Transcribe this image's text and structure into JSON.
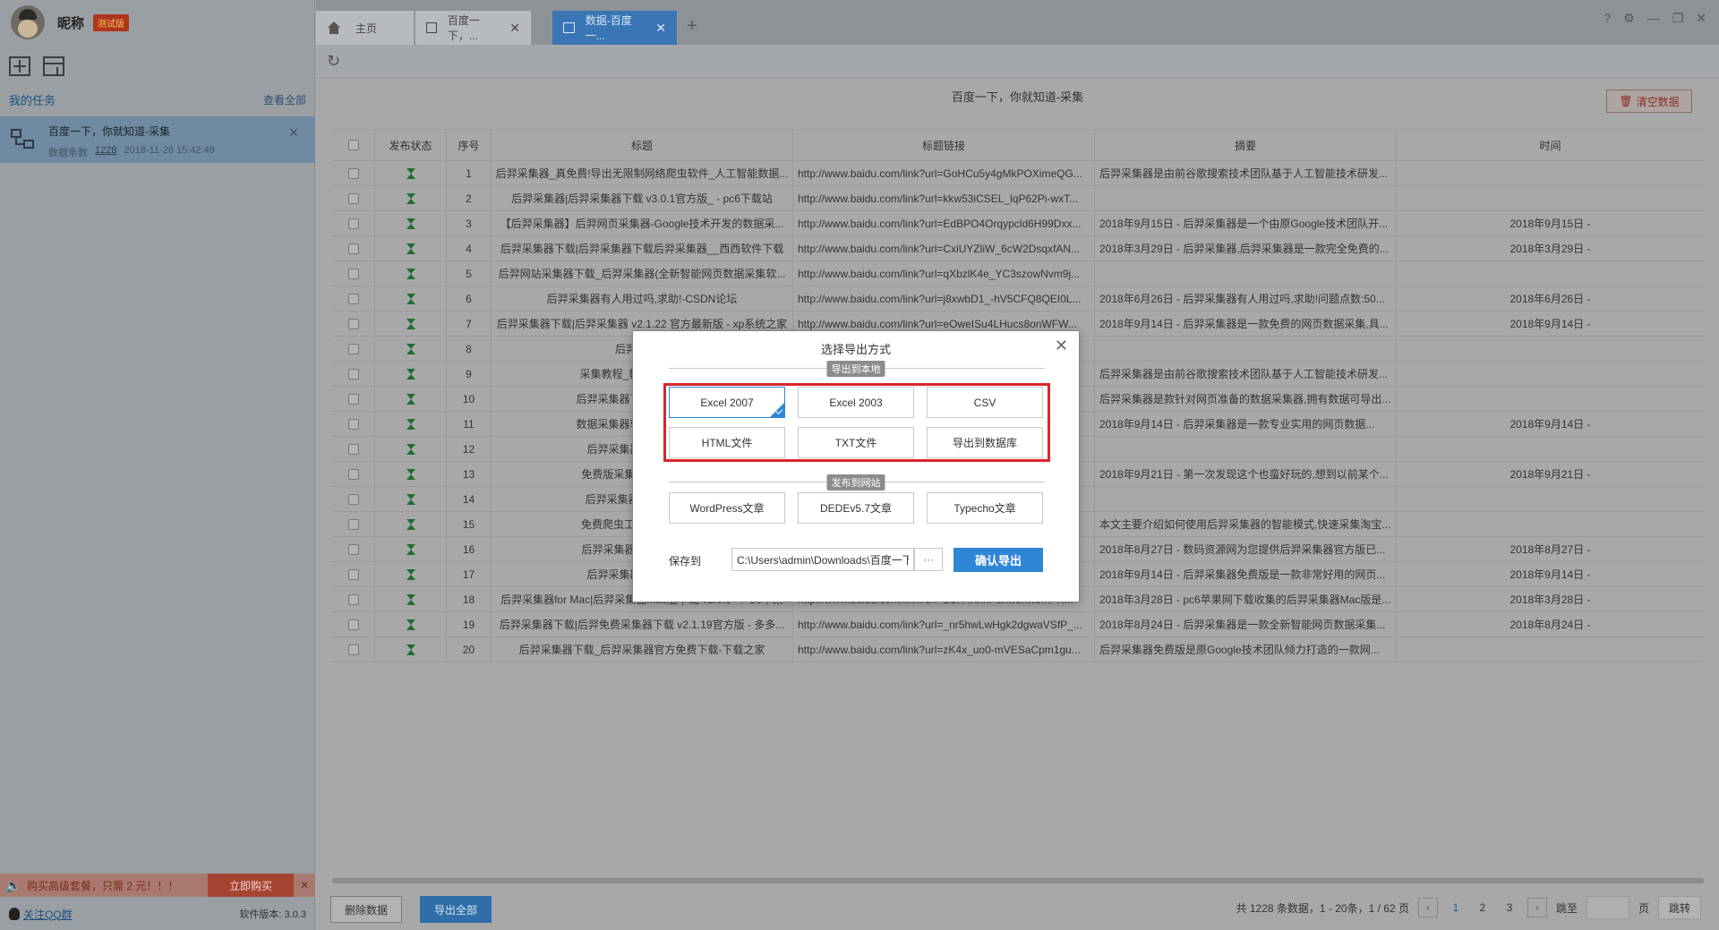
{
  "user": {
    "nickname": "昵称",
    "badge": "测试版"
  },
  "sidebar": {
    "my_tasks": "我的任务",
    "view_all": "查看全部",
    "task": {
      "title": "百度一下，你就知道-采集",
      "count_label": "数据条数",
      "count": "1228",
      "time": "2018-11-26 15:42:49"
    },
    "promo": {
      "text": "购买高级套餐，只需 2 元！！！",
      "buy": "立即购买"
    },
    "qq_link": "关注QQ群",
    "version": "软件版本: 3.0.3"
  },
  "tabs": [
    {
      "label": "主页"
    },
    {
      "label": "百度一下，..."
    },
    {
      "label": "数据-百度一..."
    }
  ],
  "content": {
    "title": "百度一下，你就知道-采集",
    "clear_button": "清空数据",
    "columns": [
      "发布状态",
      "序号",
      "标题",
      "标题链接",
      "摘要",
      "时间"
    ],
    "rows": [
      {
        "no": "1",
        "title": "后羿采集器_真免费!导出无限制网络爬虫软件_人工智能数据...",
        "link": "http://www.baidu.com/link?url=GoHCu5y4gMkPOXimeQG...",
        "summary": "后羿采集器是由前谷歌搜索技术团队基于人工智能技术研发...",
        "time": ""
      },
      {
        "no": "2",
        "title": "后羿采集器|后羿采集器下载 v3.0.1官方版_ - pc6下载站",
        "link": "http://www.baidu.com/link?url=kkw53iCSEL_lqP62Pi-wxT...",
        "summary": "",
        "time": ""
      },
      {
        "no": "3",
        "title": "【后羿采集器】后羿网页采集器-Google技术开发的数据采...",
        "link": "http://www.baidu.com/link?url=EdBPO4Orqypcld6H99Dxx...",
        "summary": "2018年9月15日 - 后羿采集器是一个由原Google技术团队开...",
        "time": "2018年9月15日 -"
      },
      {
        "no": "4",
        "title": "后羿采集器下载|后羿采集器下载后羿采集器__西西软件下载",
        "link": "http://www.baidu.com/link?url=CxiUYZliW_6cW2DsqxfAN...",
        "summary": "2018年3月29日 - 后羿采集器,后羿采集器是一款完全免费的...",
        "time": "2018年3月29日 -"
      },
      {
        "no": "5",
        "title": "后羿网站采集器下载_后羿采集器(全新智能网页数据采集软...",
        "link": "http://www.baidu.com/link?url=qXbzlK4e_YC3szowNvm9j...",
        "summary": "",
        "time": ""
      },
      {
        "no": "6",
        "title": "后羿采集器有人用过吗,求助!-CSDN论坛",
        "link": "http://www.baidu.com/link?url=j8xwbD1_-hV5CFQ8QEI0L...",
        "summary": "2018年6月26日 - 后羿采集器有人用过吗,求助!问题点数:50...",
        "time": "2018年6月26日 -"
      },
      {
        "no": "7",
        "title": "后羿采集器下载|后羿采集器 v2.1.22 官方最新版 - xp系统之家",
        "link": "http://www.baidu.com/link?url=eOweISu4LHucs8onWFW...",
        "summary": "2018年9月14日 - 后羿采集器是一款免费的网页数据采集,具...",
        "time": "2018年9月14日 -"
      },
      {
        "no": "8",
        "title": "后羿采集器",
        "link": "",
        "summary": "",
        "time": ""
      },
      {
        "no": "9",
        "title": "采集教程_教你写爬虫程序",
        "link": "",
        "summary": "后羿采集器是由前谷歌搜索技术团队基于人工智能技术研发...",
        "time": ""
      },
      {
        "no": "10",
        "title": "后羿采集器下载|后羿采集器",
        "link": "",
        "summary": "后羿采集器是款针对网页准备的数据采集器,拥有数据可导出...",
        "time": ""
      },
      {
        "no": "11",
        "title": "数据采集器软件|后羿采集器",
        "link": "",
        "summary": "2018年9月14日 - 后羿采集器是一款专业实用的网页数据...",
        "time": "2018年9月14日 -"
      },
      {
        "no": "12",
        "title": "后羿采集器下载|后羿采",
        "link": "",
        "summary": "",
        "time": ""
      },
      {
        "no": "13",
        "title": "免费版采集器 谷歌后羿采",
        "link": "",
        "summary": "2018年9月21日 - 第一次发现这个也蛮好玩的,想到以前某个...",
        "time": "2018年9月21日 -"
      },
      {
        "no": "14",
        "title": "后羿采集器下载_后羿采",
        "link": "",
        "summary": "",
        "time": ""
      },
      {
        "no": "15",
        "title": "免费爬虫工具-一招教你轻",
        "link": "",
        "summary": "本文主要介绍如何使用后羿采集器的智能模式,快速采集淘宝...",
        "time": ""
      },
      {
        "no": "16",
        "title": "后羿采集器官方版下载|网",
        "link": "",
        "summary": "2018年8月27日 - 数码资源网为您提供后羿采集器官方版已...",
        "time": "2018年8月27日 -"
      },
      {
        "no": "17",
        "title": "后羿采集器下载|后羿采",
        "link": "",
        "summary": "2018年9月14日 - 后羿采集器免费版是一款非常好用的网页...",
        "time": "2018年9月14日 -"
      },
      {
        "no": "18",
        "title": "后羿采集器for Mac|后羿采集器Mac版下载 v2.0.3 - PC6苹果",
        "link": "http://www.baidu.com/link?url=LCK4XhhPaxw5hwbmFR...",
        "summary": "2018年3月28日 - pc6苹果网下载收集的后羿采集器Mac版是...",
        "time": "2018年3月28日 -"
      },
      {
        "no": "19",
        "title": "后羿采集器下载|后羿免费采集器下载 v2.1.19官方版 - 多多...",
        "link": "http://www.baidu.com/link?url=_nr5hwLwHgk2dgwaVSfP_...",
        "summary": "2018年8月24日 - 后羿采集器是一款全新智能网页数据采集...",
        "time": "2018年8月24日 -"
      },
      {
        "no": "20",
        "title": "后羿采集器下载_后羿采集器官方免费下载-下载之家",
        "link": "http://www.baidu.com/link?url=zK4x_uo0-mVESaCpm1gu...",
        "summary": "后羿采集器免费版是原Google技术团队倾力打造的一款网...",
        "time": ""
      }
    ],
    "delete_button": "删除数据",
    "export_all_button": "导出全部",
    "pager": {
      "summary": "共 1228 条数据，1 - 20条，1 / 62 页",
      "pages": [
        "1",
        "2",
        "3"
      ],
      "jump_label": "跳至",
      "page_unit": "页",
      "jump_button": "跳转"
    }
  },
  "modal": {
    "title": "选择导出方式",
    "local_section": "导出到本地",
    "local_options": [
      "Excel 2007",
      "Excel 2003",
      "CSV",
      "HTML文件",
      "TXT文件",
      "导出到数据库"
    ],
    "publish_section": "发布到网站",
    "publish_options": [
      "WordPress文章",
      "DEDEv5.7文章",
      "Typecho文章"
    ],
    "save_label": "保存到",
    "save_path": "C:\\Users\\admin\\Downloads\\百度一下",
    "browse": "···",
    "confirm": "确认导出"
  }
}
